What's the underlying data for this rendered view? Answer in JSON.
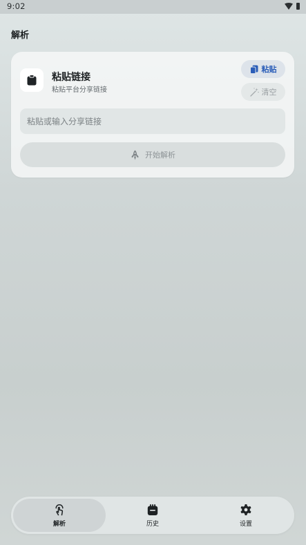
{
  "status_bar": {
    "time": "9:02",
    "icons": [
      "wifi-icon",
      "battery-icon"
    ]
  },
  "page": {
    "title": "解析"
  },
  "card": {
    "icon": "clipboard-icon",
    "title": "粘贴链接",
    "subtitle": "粘贴平台分享链接",
    "paste_button": {
      "label": "粘贴",
      "icon": "copy-icon"
    },
    "clear_button": {
      "label": "清空",
      "icon": "magic-wand-icon"
    },
    "input": {
      "value": "",
      "placeholder": "粘贴或输入分享链接"
    },
    "start_button": {
      "label": "开始解析",
      "icon": "rocket-icon"
    }
  },
  "bottom_nav": {
    "items": [
      {
        "label": "解析",
        "icon": "touch-icon",
        "active": true
      },
      {
        "label": "历史",
        "icon": "calendar-icon",
        "active": false
      },
      {
        "label": "设置",
        "icon": "gear-icon",
        "active": false
      }
    ]
  },
  "colors": {
    "accent": "#2a5db8",
    "background": "#cfd6d6",
    "card": "#f6f8f8",
    "disabled_text": "#8d9396"
  }
}
